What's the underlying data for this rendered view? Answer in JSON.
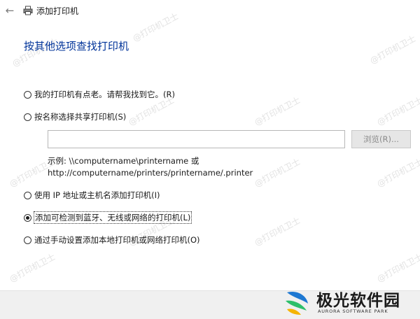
{
  "window": {
    "title": "添加打印机",
    "back_glyph": "←"
  },
  "heading": "按其他选项查找打印机",
  "options": [
    {
      "label": "我的打印机有点老。请帮我找到它。(R)",
      "checked": false
    },
    {
      "label": "按名称选择共享打印机(S)",
      "checked": false
    },
    {
      "label": "使用 IP 地址或主机名添加打印机(I)",
      "checked": false
    },
    {
      "label": "添加可检测到蓝牙、无线或网络的打印机(L)",
      "checked": true
    },
    {
      "label": "通过手动设置添加本地打印机或网络打印机(O)",
      "checked": false
    }
  ],
  "share_input": {
    "value": ""
  },
  "browse_button": {
    "label": "浏览(R)...",
    "enabled": false
  },
  "example": {
    "line1": "示例: \\\\computername\\printername 或",
    "line2": "http://computername/printers/printername/.printer"
  },
  "watermark": {
    "text": "@打印机卫士"
  },
  "brand": {
    "name": "极光软件园",
    "sub": "AURORA SOFTWARE PARK"
  },
  "colors": {
    "heading": "#003399",
    "brand_blue": "#1e78d2",
    "brand_green": "#2dbf6a",
    "brand_yellow": "#f5b400"
  }
}
